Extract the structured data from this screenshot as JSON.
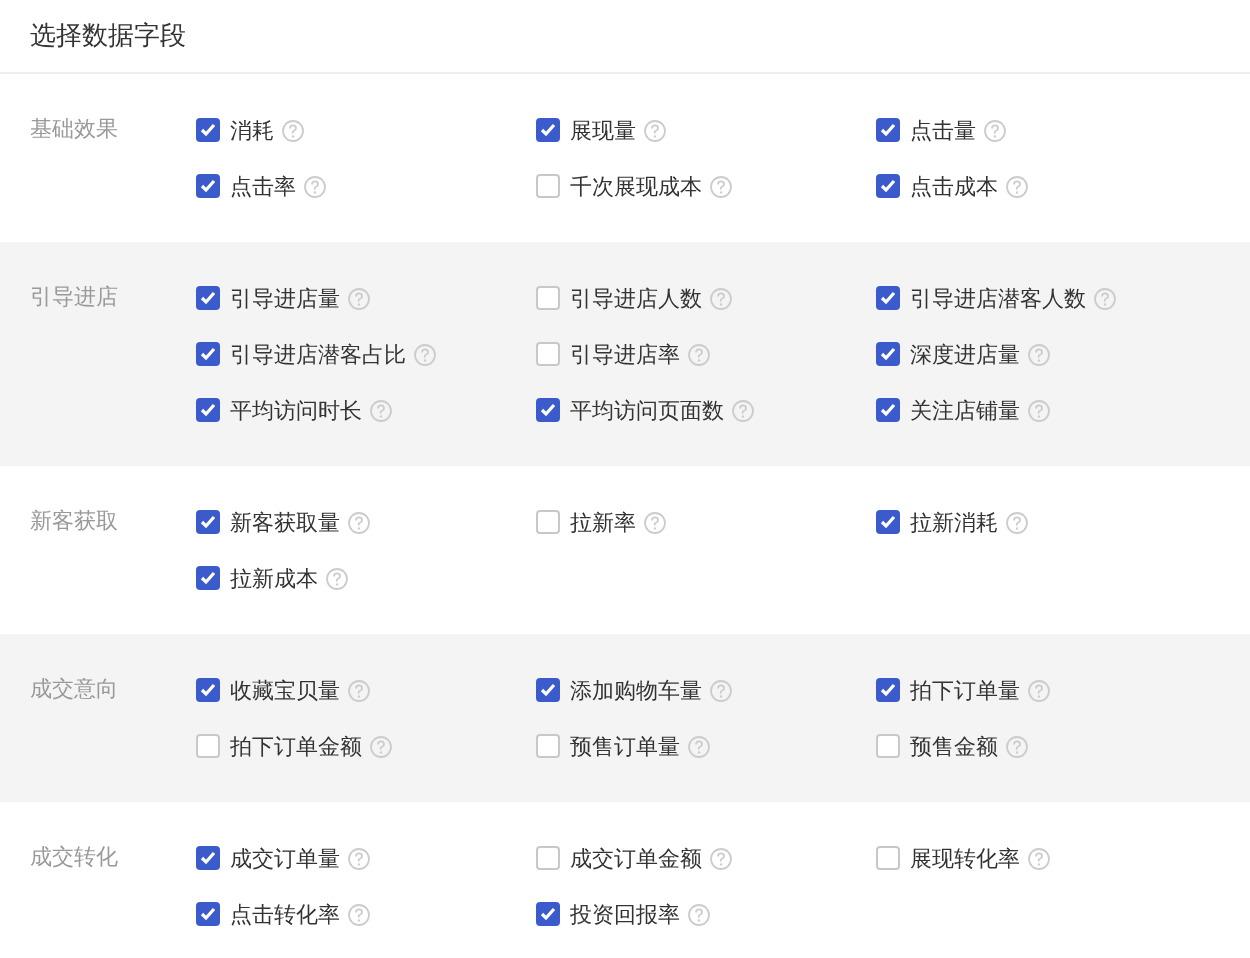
{
  "title": "选择数据字段",
  "sections": [
    {
      "label": "基础效果",
      "fields": [
        {
          "label": "消耗",
          "checked": true
        },
        {
          "label": "展现量",
          "checked": true
        },
        {
          "label": "点击量",
          "checked": true
        },
        {
          "label": "点击率",
          "checked": true
        },
        {
          "label": "千次展现成本",
          "checked": false
        },
        {
          "label": "点击成本",
          "checked": true
        }
      ]
    },
    {
      "label": "引导进店",
      "fields": [
        {
          "label": "引导进店量",
          "checked": true
        },
        {
          "label": "引导进店人数",
          "checked": false
        },
        {
          "label": "引导进店潜客人数",
          "checked": true
        },
        {
          "label": "引导进店潜客占比",
          "checked": true
        },
        {
          "label": "引导进店率",
          "checked": false
        },
        {
          "label": "深度进店量",
          "checked": true
        },
        {
          "label": "平均访问时长",
          "checked": true
        },
        {
          "label": "平均访问页面数",
          "checked": true
        },
        {
          "label": "关注店铺量",
          "checked": true
        }
      ]
    },
    {
      "label": "新客获取",
      "fields": [
        {
          "label": "新客获取量",
          "checked": true
        },
        {
          "label": "拉新率",
          "checked": false
        },
        {
          "label": "拉新消耗",
          "checked": true
        },
        {
          "label": "拉新成本",
          "checked": true
        }
      ]
    },
    {
      "label": "成交意向",
      "fields": [
        {
          "label": "收藏宝贝量",
          "checked": true
        },
        {
          "label": "添加购物车量",
          "checked": true
        },
        {
          "label": "拍下订单量",
          "checked": true
        },
        {
          "label": "拍下订单金额",
          "checked": false
        },
        {
          "label": "预售订单量",
          "checked": false
        },
        {
          "label": "预售金额",
          "checked": false
        }
      ]
    },
    {
      "label": "成交转化",
      "fields": [
        {
          "label": "成交订单量",
          "checked": true
        },
        {
          "label": "成交订单金额",
          "checked": false
        },
        {
          "label": "展现转化率",
          "checked": false
        },
        {
          "label": "点击转化率",
          "checked": true
        },
        {
          "label": "投资回报率",
          "checked": true
        }
      ]
    }
  ]
}
